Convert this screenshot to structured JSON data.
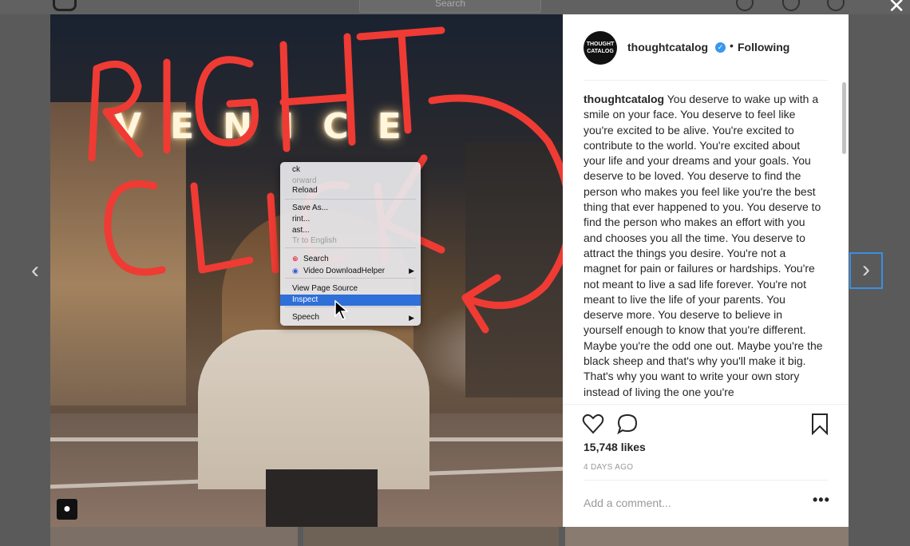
{
  "topbar": {
    "search_placeholder": "Search"
  },
  "context_menu": {
    "items": [
      {
        "label": "Back",
        "disabled": false,
        "shown": "ck"
      },
      {
        "label": "Forward",
        "disabled": true,
        "shown": "orward"
      },
      {
        "label": "Reload",
        "disabled": false,
        "shown": "Reload"
      },
      {
        "label": "Save As...",
        "disabled": false,
        "shown": "Save As..."
      },
      {
        "label": "Print...",
        "disabled": false,
        "shown": "rint..."
      },
      {
        "label": "Cast...",
        "disabled": false,
        "shown": "ast..."
      },
      {
        "label": "Translate to English",
        "disabled": true,
        "shown": "Tr     to English"
      },
      {
        "label": "Search",
        "disabled": false,
        "shown": "Search"
      },
      {
        "label": "Video DownloadHelper",
        "disabled": false,
        "shown": "Video DownloadHelper"
      },
      {
        "label": "View Page Source",
        "disabled": false,
        "shown": "View Page Source"
      },
      {
        "label": "Inspect",
        "disabled": false,
        "shown": "Inspect"
      },
      {
        "label": "Speech",
        "disabled": false,
        "shown": "Speech"
      }
    ]
  },
  "photo": {
    "sign_text": "VENICE",
    "annotation": [
      "RIGHT",
      "CLICK"
    ]
  },
  "post": {
    "avatar_text": "THOUGHT CATALOG",
    "username": "thoughtcatalog",
    "follow_status": "Following",
    "caption_user": "thoughtcatalog",
    "caption_text": "You deserve to wake up with a smile on your face. You deserve to feel like you're excited to be alive. You're excited to contribute to the world. You're excited about your life and your dreams and your goals. You deserve to be loved. You deserve to find the person who makes you feel like you're the best thing that ever happened to you. You deserve to find the person who makes an effort with you and chooses you all the time. You deserve to attract the things you desire. You're not a magnet for pain or failures or hardships. You're not meant to live a sad life forever. You're not meant to live the life of your parents. You deserve more. You deserve to believe in yourself enough to know that you're different. Maybe you're the odd one out. Maybe you're the black sheep and that's why you'll make it big. That's why you want to write your own story instead of living the one you're",
    "likes": "15,748 likes",
    "time_ago": "4 DAYS AGO",
    "add_comment_placeholder": "Add a comment...",
    "more_label": "•••"
  },
  "colors": {
    "accent": "#3897f0",
    "menu_highlight": "#2e6fd8",
    "annotation_red": "#ef3b34"
  }
}
